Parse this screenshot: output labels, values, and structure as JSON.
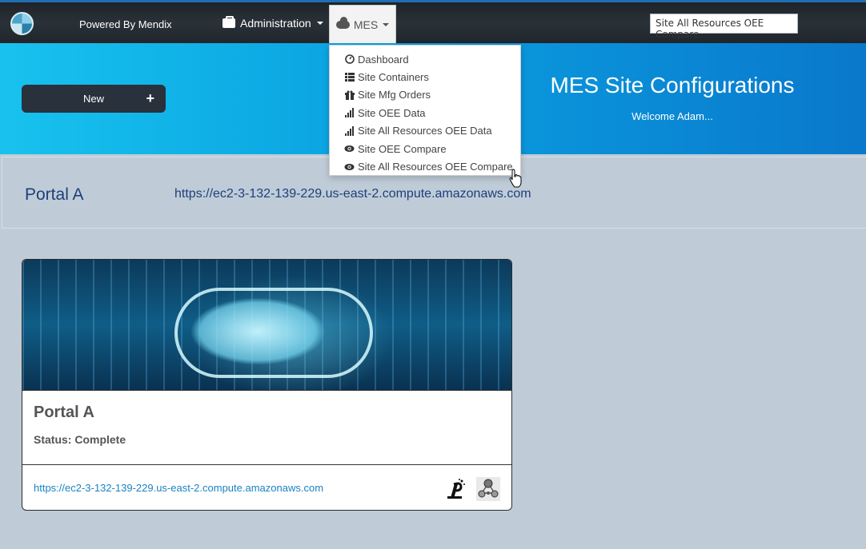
{
  "navbar": {
    "brand": "Powered By Mendix",
    "administration_label": "Administration",
    "mes_label": "MES",
    "search_value": "Site All Resources OEE Compare"
  },
  "hero": {
    "new_button_label": "New",
    "title": "MES Site Configurations",
    "welcome": "Welcome Adam..."
  },
  "portal": {
    "name": "Portal A",
    "url": "https://ec2-3-132-139-229.us-east-2.compute.amazonaws.com"
  },
  "card": {
    "title": "Portal A",
    "status": "Status: Complete",
    "link": "https://ec2-3-132-139-229.us-east-2.compute.amazonaws.com"
  },
  "mes_menu": {
    "items": [
      {
        "label": "Dashboard",
        "icon": "dashboard-icon"
      },
      {
        "label": "Site Containers",
        "icon": "list-icon"
      },
      {
        "label": "Site Mfg Orders",
        "icon": "gift-icon"
      },
      {
        "label": "Site OEE Data",
        "icon": "signal-icon"
      },
      {
        "label": "Site All Resources OEE Data",
        "icon": "signal-icon"
      },
      {
        "label": "Site OEE Compare",
        "icon": "eye-icon"
      },
      {
        "label": "Site All Resources OEE Compare",
        "icon": "eye-icon"
      }
    ]
  },
  "colors": {
    "accent": "#1f6fb2",
    "hero_start": "#18c2ee",
    "hero_end": "#0a78cc",
    "page_bg": "#bfccd8",
    "link": "#1b82c5",
    "portal_text": "#1f3f7a"
  }
}
